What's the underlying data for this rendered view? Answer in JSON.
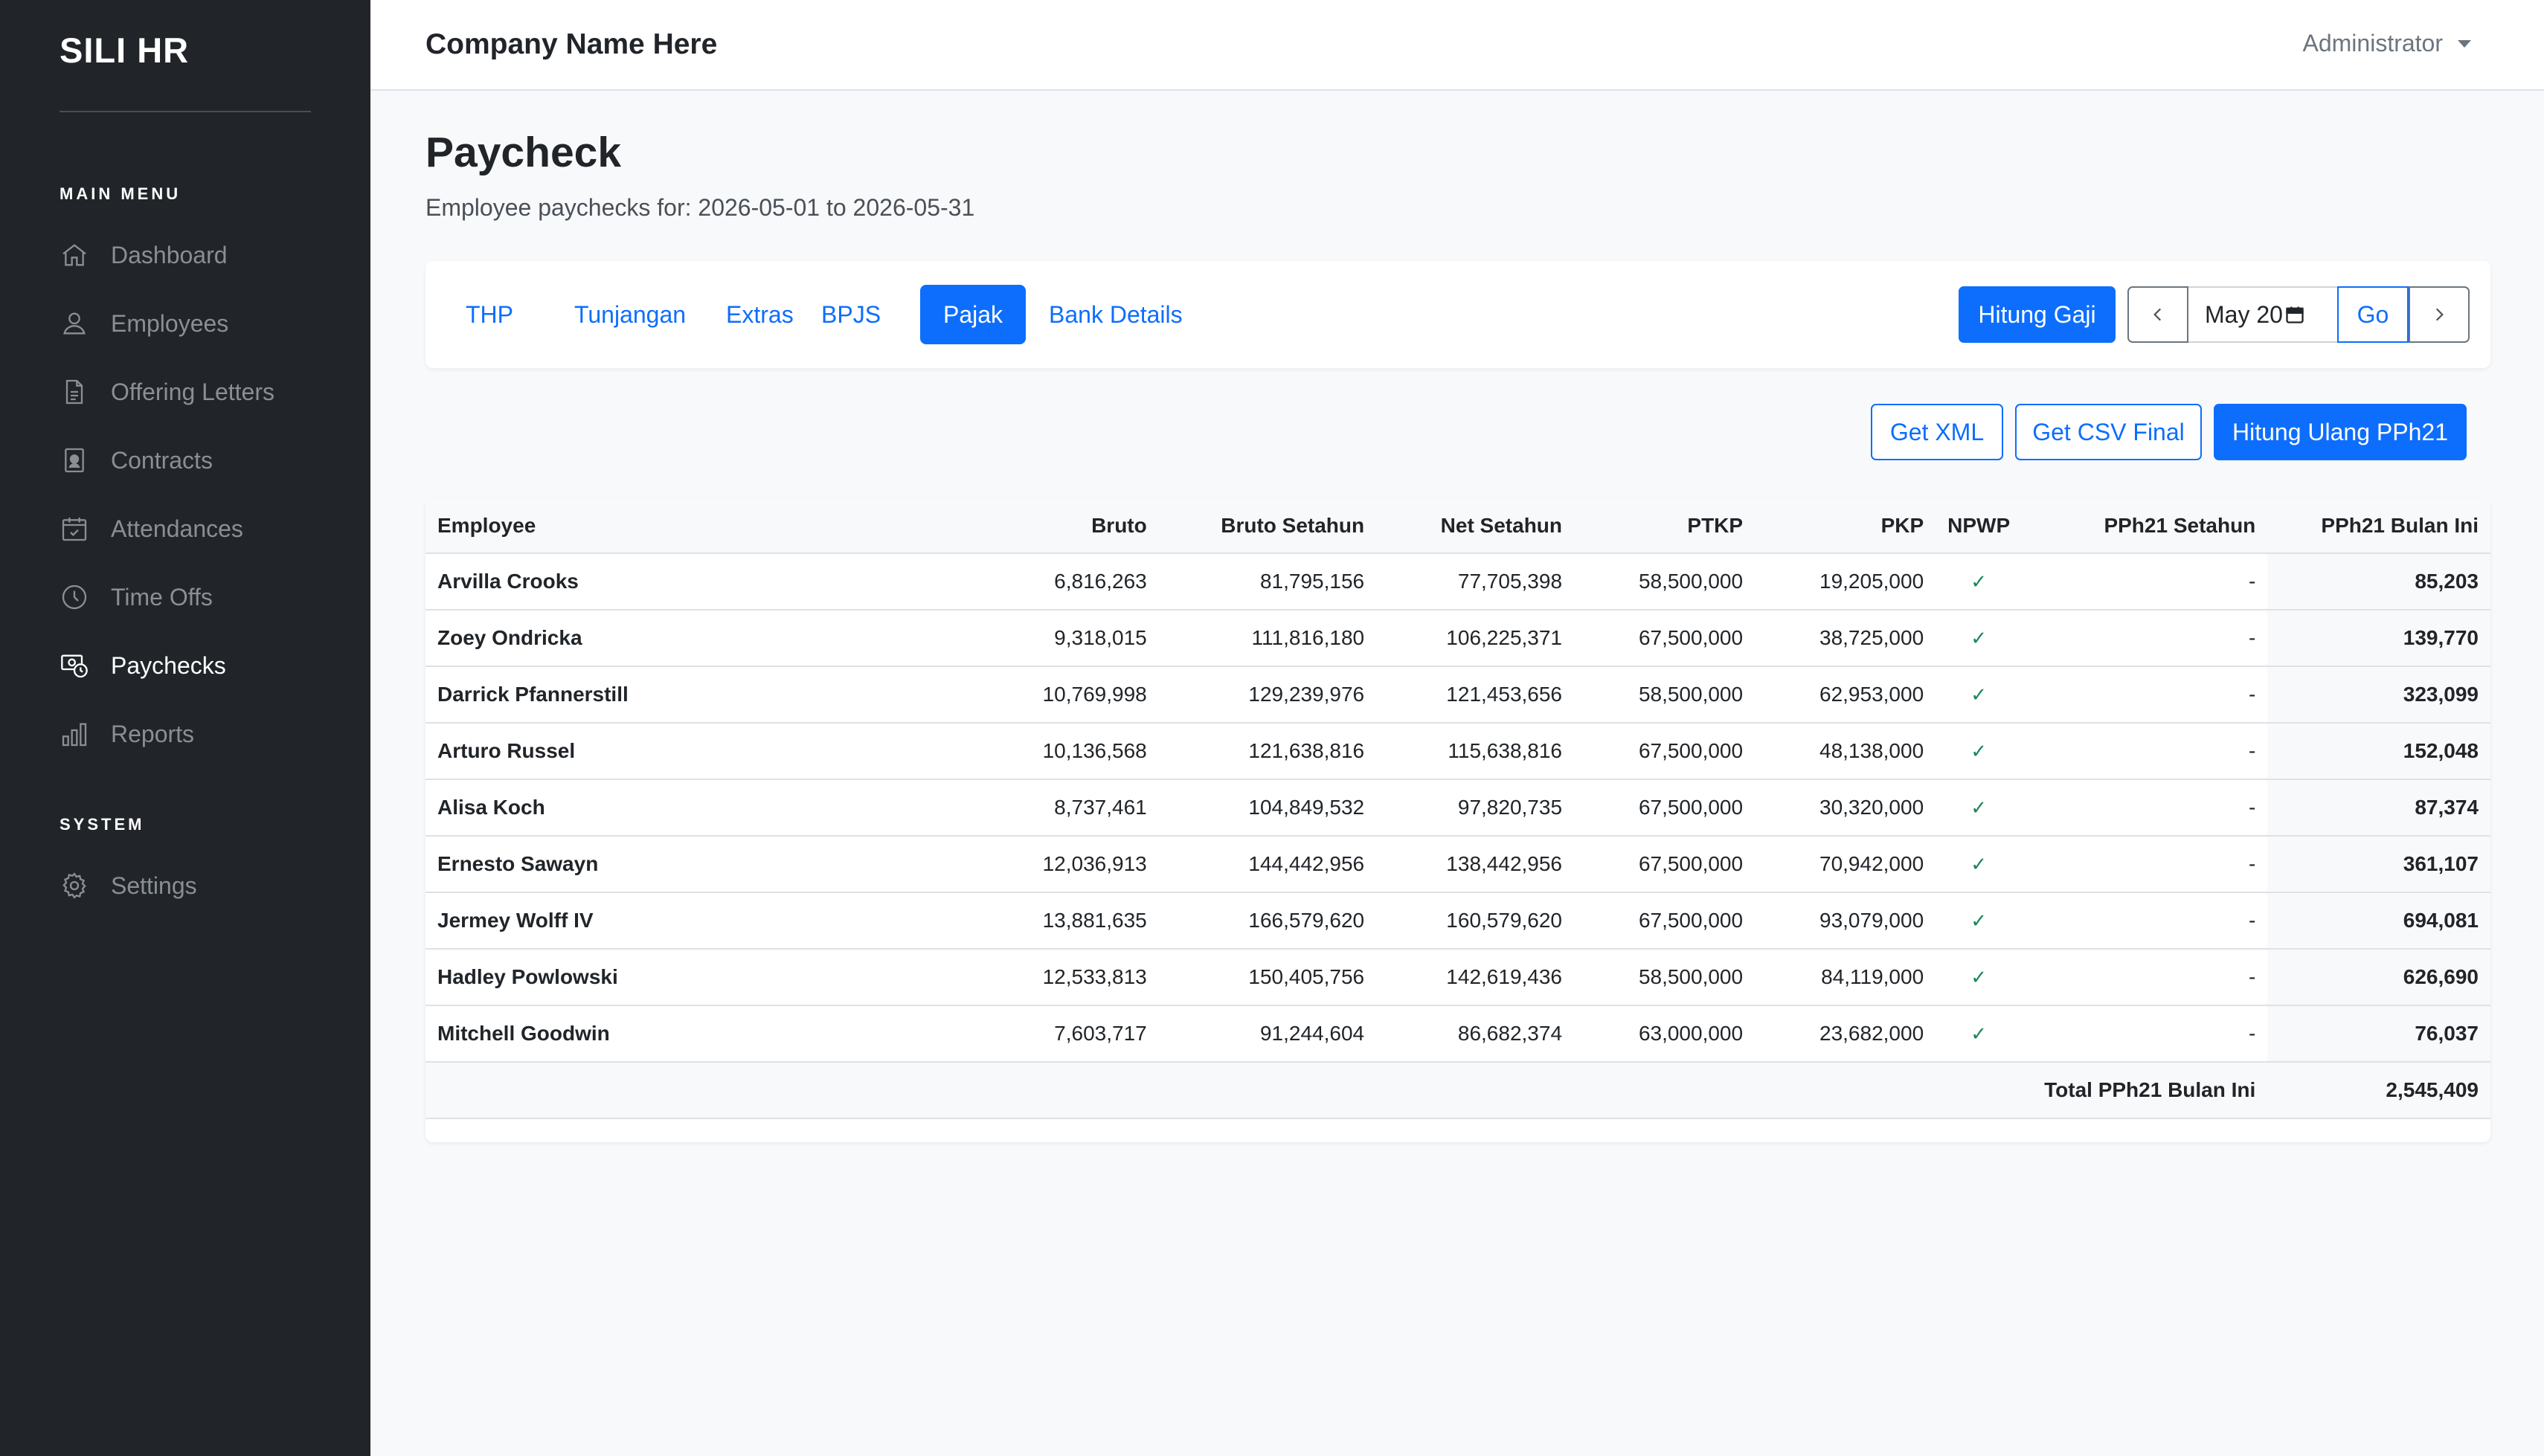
{
  "sidebar": {
    "brand": "SILI HR",
    "main_menu_label": "MAIN MENU",
    "system_label": "SYSTEM",
    "items": [
      {
        "label": "Dashboard",
        "icon": "home-icon"
      },
      {
        "label": "Employees",
        "icon": "user-icon"
      },
      {
        "label": "Offering Letters",
        "icon": "document-icon"
      },
      {
        "label": "Contracts",
        "icon": "contract-badge-icon"
      },
      {
        "label": "Attendances",
        "icon": "calendar-check-icon"
      },
      {
        "label": "Time Offs",
        "icon": "clock-icon"
      },
      {
        "label": "Paychecks",
        "icon": "paycheck-icon",
        "active": true
      },
      {
        "label": "Reports",
        "icon": "bar-chart-icon"
      }
    ],
    "system_items": [
      {
        "label": "Settings",
        "icon": "gear-icon"
      }
    ]
  },
  "topbar": {
    "company": "Company Name Here",
    "user": "Administrator"
  },
  "page": {
    "title": "Paycheck",
    "subtitle": "Employee paychecks for: 2026-05-01 to 2026-05-31"
  },
  "tabs": [
    "THP",
    "Tunjangan",
    "Extras",
    "BPJS",
    "Pajak",
    "Bank Details"
  ],
  "active_tab": "Pajak",
  "toolbar": {
    "hitung_gaji": "Hitung Gaji",
    "month_value": "May 20",
    "go": "Go"
  },
  "actions": {
    "get_xml": "Get XML",
    "get_csv_final": "Get CSV Final",
    "hitung_ulang": "Hitung Ulang PPh21"
  },
  "table": {
    "columns": [
      "Employee",
      "Bruto",
      "Bruto Setahun",
      "Net Setahun",
      "PTKP",
      "PKP",
      "NPWP",
      "PPh21 Setahun",
      "PPh21 Bulan Ini"
    ],
    "rows": [
      [
        "Arvilla Crooks",
        "6,816,263",
        "81,795,156",
        "77,705,398",
        "58,500,000",
        "19,205,000",
        "✓",
        "-",
        "85,203"
      ],
      [
        "Zoey Ondricka",
        "9,318,015",
        "111,816,180",
        "106,225,371",
        "67,500,000",
        "38,725,000",
        "✓",
        "-",
        "139,770"
      ],
      [
        "Darrick Pfannerstill",
        "10,769,998",
        "129,239,976",
        "121,453,656",
        "58,500,000",
        "62,953,000",
        "✓",
        "-",
        "323,099"
      ],
      [
        "Arturo Russel",
        "10,136,568",
        "121,638,816",
        "115,638,816",
        "67,500,000",
        "48,138,000",
        "✓",
        "-",
        "152,048"
      ],
      [
        "Alisa Koch",
        "8,737,461",
        "104,849,532",
        "97,820,735",
        "67,500,000",
        "30,320,000",
        "✓",
        "-",
        "87,374"
      ],
      [
        "Ernesto Sawayn",
        "12,036,913",
        "144,442,956",
        "138,442,956",
        "67,500,000",
        "70,942,000",
        "✓",
        "-",
        "361,107"
      ],
      [
        "Jermey Wolff IV",
        "13,881,635",
        "166,579,620",
        "160,579,620",
        "67,500,000",
        "93,079,000",
        "✓",
        "-",
        "694,081"
      ],
      [
        "Hadley Powlowski",
        "12,533,813",
        "150,405,756",
        "142,619,436",
        "58,500,000",
        "84,119,000",
        "✓",
        "-",
        "626,690"
      ],
      [
        "Mitchell Goodwin",
        "7,603,717",
        "91,244,604",
        "86,682,374",
        "63,000,000",
        "23,682,000",
        "✓",
        "-",
        "76,037"
      ]
    ],
    "total_label": "Total PPh21 Bulan Ini",
    "total_value": "2,545,409"
  },
  "colors": {
    "sidebar_bg": "#212529",
    "accent": "#0d6efd",
    "check": "#198754"
  }
}
